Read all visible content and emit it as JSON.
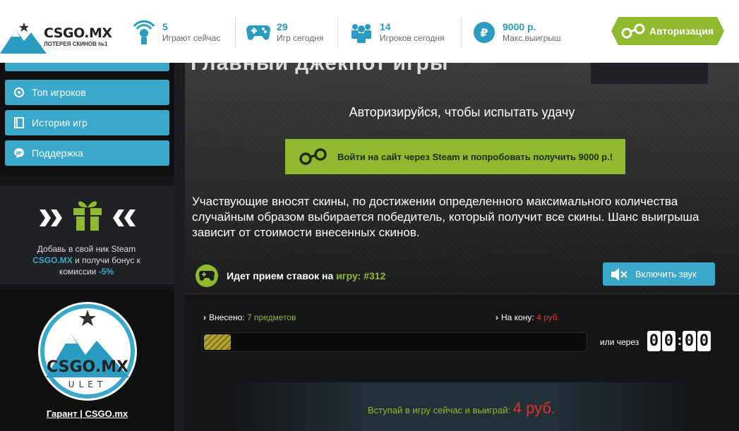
{
  "header": {
    "logo_name": "CSGO.MX",
    "logo_tag": "ЛОТЕРЕЯ СКИНОВ №1",
    "stats": [
      {
        "value": "5",
        "label": "Играют сейчас",
        "icon": "player-icon"
      },
      {
        "value": "29",
        "label": "Игр сегодня",
        "icon": "gamepad-icon"
      },
      {
        "value": "14",
        "label": "Игроков сегодня",
        "icon": "users-icon"
      },
      {
        "value": "9000 р.",
        "label": "Макс.выигрыш",
        "icon": "ruble-icon"
      }
    ],
    "auth_label": "Авторизация"
  },
  "sidebar": {
    "items": [
      {
        "label": "Топ игроков",
        "icon": "top-players-icon"
      },
      {
        "label": "История игр",
        "icon": "history-icon"
      },
      {
        "label": "Поддержка",
        "icon": "support-icon"
      }
    ],
    "promo_line1": "Добавь в свой ник Steam",
    "promo_brand": "CSGO.MX",
    "promo_line2": " и получи бонус к комиссии ",
    "promo_pct": "-5%",
    "guarant_label": "Гарант | CSGO.mx",
    "guarant_logo_text": "CSGO.MX",
    "guarant_logo_sub": "ULET"
  },
  "main": {
    "auth_message": "Авторизируйся, чтобы испытать удачу",
    "steam_button": "Войти на сайт через Steam и попробовать получить 9000 р.!",
    "description": "Участвующие вносят скины, по достижении определенного максимального количества случайным образом выбирается победитель, который получит все скины. Шанс выигрыша зависит от стоимости внесенных скинов.",
    "status_prefix": "Идет прием ставок на ",
    "status_game": "игру: #312",
    "sound_button": "Включить звук",
    "invested_label": "Внесено: ",
    "invested_value": "7 предметов",
    "pot_label": "На кону: ",
    "pot_value": "4 руб.",
    "progress": 0.07,
    "or_label": "или через",
    "timer": [
      "0",
      "0",
      "0",
      "0"
    ],
    "join_text": "Вступай в игру сейчас и выиграй: ",
    "join_sum": "4 руб."
  },
  "colors": {
    "accent_blue": "#3aa8cb",
    "accent_green": "#8fba2f",
    "accent_red": "#e03030"
  }
}
